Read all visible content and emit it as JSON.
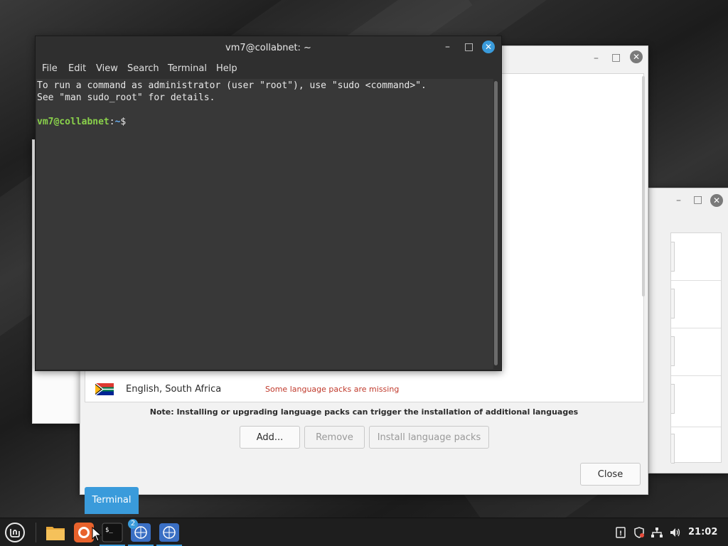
{
  "terminal": {
    "title": "vm7@collabnet: ~",
    "menu": [
      "File",
      "Edit",
      "View",
      "Search",
      "Terminal",
      "Help"
    ],
    "lines": [
      "To run a command as administrator (user \"root\"), use \"sudo <command>\".",
      "See \"man sudo_root\" for details."
    ],
    "prompt_user": "vm7@collabnet",
    "prompt_sep": ":",
    "prompt_path": "~",
    "prompt_symbol": "$"
  },
  "language_window": {
    "rows": [
      {
        "name": "English, South Africa",
        "status": "Some language packs are missing",
        "flag": "south-africa-flag"
      }
    ],
    "note": "Note: Installing or upgrading language packs can trigger the installation of additional languages",
    "buttons": {
      "add": "Add...",
      "remove": "Remove",
      "install": "Install language packs",
      "close": "Close"
    }
  },
  "tooltip": "Terminal",
  "taskbar": {
    "badge_count": "2",
    "clock": "21:02"
  },
  "colors": {
    "accent": "#3a9bdb",
    "prompt_user": "#8ad14b",
    "prompt_path": "#6ab0f3",
    "warning": "#c0392b"
  }
}
